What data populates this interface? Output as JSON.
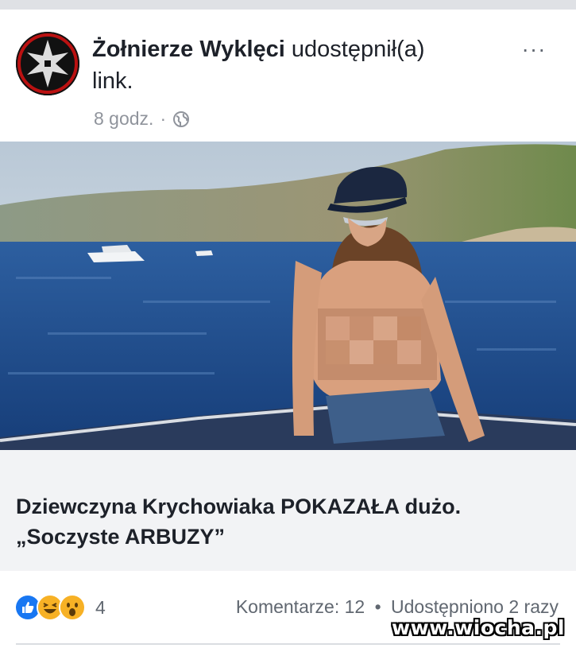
{
  "post": {
    "author": "Żołnierze Wyklęci",
    "action": "udostępnił(a)",
    "action_line2": "link.",
    "time": "8 godz.",
    "separator": "·",
    "privacy_icon": "globe-icon",
    "more_label": "···"
  },
  "link": {
    "title_line1": "Dziewczyna Krychowiaka POKAZAŁA dużo.",
    "title_line2": "„Soczyste ARBUZY”"
  },
  "reactions": {
    "icons": [
      "like-icon",
      "haha-icon",
      "wow-icon"
    ],
    "count": "4"
  },
  "stats": {
    "comments": "Komentarze: 12",
    "separator": "•",
    "shares": "Udostępniono 2 razy"
  },
  "watermark": "www.wiocha.pl",
  "colors": {
    "like_blue": "#1877f2",
    "emoji_yellow": "#f7b125",
    "meta_gray": "#90949c",
    "caption_bg": "#f2f3f5"
  }
}
